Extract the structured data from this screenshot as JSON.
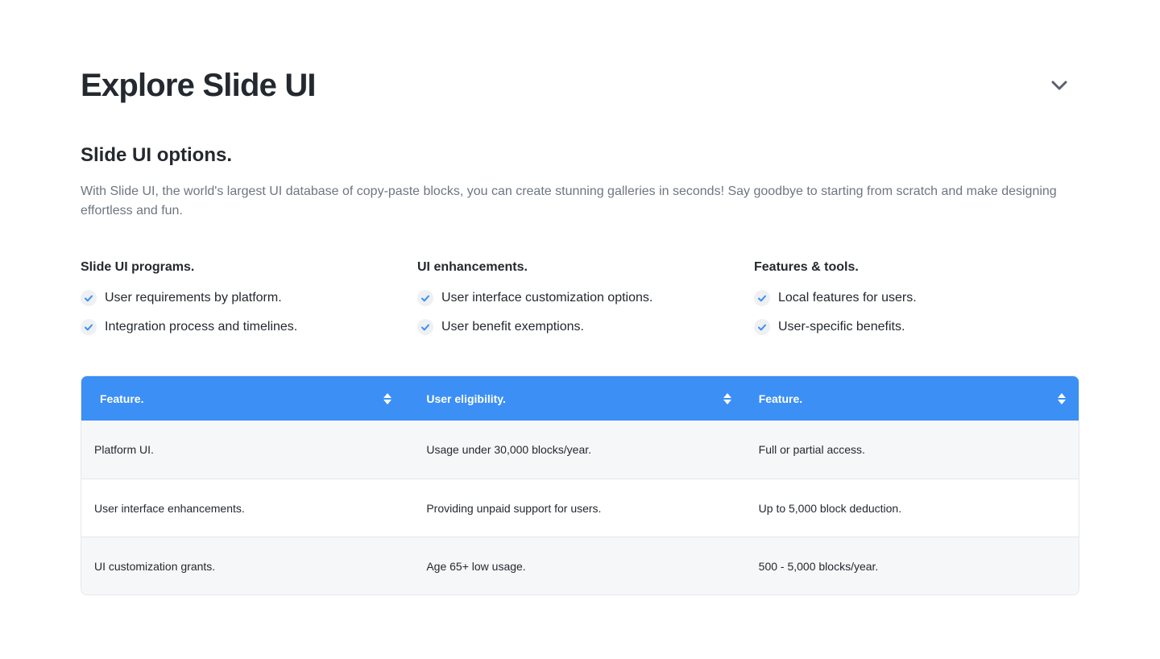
{
  "header": {
    "title": "Explore Slide UI",
    "collapse_icon": "chevron-down-icon"
  },
  "section": {
    "title": "Slide UI options.",
    "description": "With Slide UI, the world's largest UI database of copy-paste blocks, you can create stunning galleries in seconds! Say goodbye to starting from scratch and make designing effortless and fun."
  },
  "features": [
    {
      "heading": "Slide UI programs.",
      "items": [
        "User requirements by platform.",
        "Integration process and timelines."
      ]
    },
    {
      "heading": "UI enhancements.",
      "items": [
        "User interface customization options.",
        "User benefit exemptions."
      ]
    },
    {
      "heading": "Features & tools.",
      "items": [
        "Local features for users.",
        "User-specific benefits."
      ]
    }
  ],
  "table": {
    "header_color": "#3b8ff5",
    "columns": [
      "Feature.",
      "User eligibility.",
      "Feature."
    ],
    "rows": [
      [
        "Platform UI.",
        "Usage under 30,000 blocks/year.",
        "Full or partial access."
      ],
      [
        "User interface enhancements.",
        "Providing unpaid support for users.",
        "Up to 5,000 block deduction."
      ],
      [
        "UI customization grants.",
        "Age 65+ low usage.",
        "500 - 5,000 blocks/year."
      ]
    ]
  },
  "colors": {
    "accent": "#3b8ff5",
    "check": "#3b8ff5",
    "text": "#24292f",
    "muted": "#6e7681"
  }
}
